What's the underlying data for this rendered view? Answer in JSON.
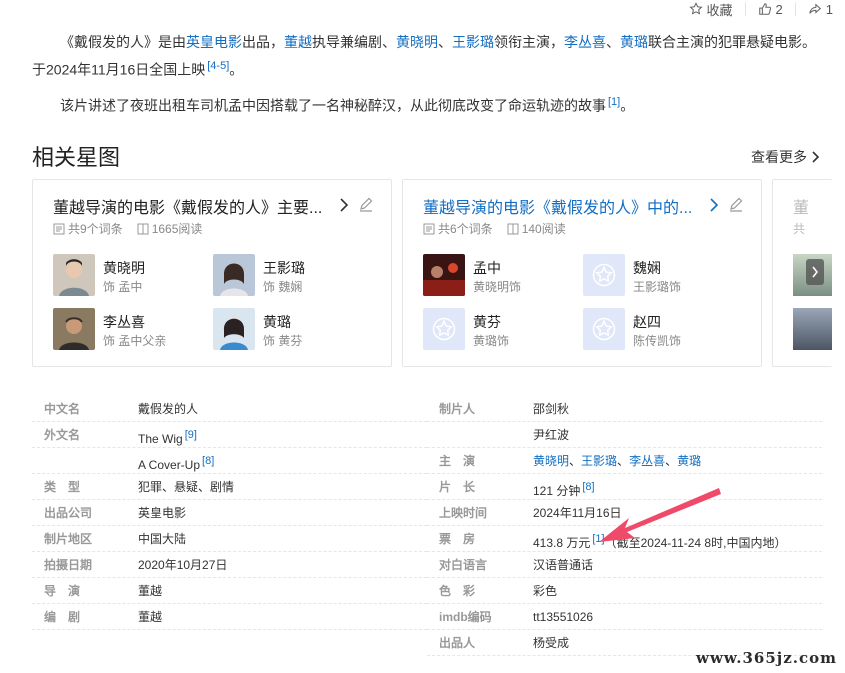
{
  "topbar": {
    "collect": "收藏",
    "like_count": "2",
    "share_count": "1"
  },
  "intro": {
    "p1": {
      "t1": "《戴假发的人》是由",
      "l1": "英皇电影",
      "t2": "出品，",
      "l2": "董越",
      "t3": "执导兼编剧、",
      "l3": "黄晓明",
      "t4": "、",
      "l4": "王影璐",
      "t5": "领衔主演，",
      "l5": "李丛喜",
      "t6": "、",
      "l6": "黄璐",
      "t7": "联合主演的犯罪悬疑电影。于2024年11月16日全国上映",
      "ref": "[4-5]",
      "t8": "。"
    },
    "p2": {
      "text": "该片讲述了夜班出租车司机孟中因搭载了一名神秘醉汉，从此彻底改变了命运轨迹的故事",
      "ref": "[1]",
      "end": "。"
    }
  },
  "section": {
    "title": "相关星图",
    "more": "查看更多"
  },
  "cards": [
    {
      "title": "董越导演的电影《戴假发的人》主要...",
      "entries": "共9个词条",
      "views": "1665阅读",
      "people": [
        {
          "name": "黄晓明",
          "role": "饰 孟中"
        },
        {
          "name": "王影璐",
          "role": "饰 魏娴"
        },
        {
          "name": "李丛喜",
          "role": "饰 孟中父亲"
        },
        {
          "name": "黄璐",
          "role": "饰 黄芬"
        }
      ]
    },
    {
      "title": "董越导演的电影《戴假发的人》中的...",
      "entries": "共6个词条",
      "views": "140阅读",
      "people": [
        {
          "name": "孟中",
          "role": "黄晓明饰"
        },
        {
          "name": "魏娴",
          "role": "王影璐饰"
        },
        {
          "name": "黄芬",
          "role": "黄璐饰"
        },
        {
          "name": "赵四",
          "role": "陈传凯饰"
        }
      ]
    },
    {
      "title": "董",
      "meta": "共"
    }
  ],
  "info": {
    "left": [
      {
        "k": "中文名",
        "v": "戴假发的人"
      },
      {
        "k": "外文名",
        "v": "The Wig",
        "ref": "[9]"
      },
      {
        "k": "",
        "v": "A Cover-Up",
        "ref": "[8]"
      },
      {
        "k": "类　型",
        "v": "犯罪、悬疑、剧情"
      },
      {
        "k": "出品公司",
        "v": "英皇电影"
      },
      {
        "k": "制片地区",
        "v": "中国大陆"
      },
      {
        "k": "拍摄日期",
        "v": "2020年10月27日"
      },
      {
        "k": "导　演",
        "v": "董越"
      },
      {
        "k": "编　剧",
        "v": "董越"
      }
    ],
    "right": [
      {
        "k": "制片人",
        "v": "邵剑秋"
      },
      {
        "k": "",
        "v": "尹红波"
      },
      {
        "k": "主　演",
        "links": [
          "黄晓明",
          "王影璐",
          "李丛喜",
          "黄璐"
        ],
        "sep": "、"
      },
      {
        "k": "片　长",
        "v": "121 分钟",
        "ref": "[8]"
      },
      {
        "k": "上映时间",
        "v": "2024年11月16日"
      },
      {
        "k": "票　房",
        "v": "413.8 万元",
        "ref": "[1]",
        "note": "（截至2024-11-24 8时,中国内地）"
      },
      {
        "k": "对白语言",
        "v": "汉语普通话"
      },
      {
        "k": "色　彩",
        "v": "彩色"
      },
      {
        "k": "imdb编码",
        "v": "tt13551026"
      },
      {
        "k": "出品人",
        "v": "杨受成"
      }
    ]
  },
  "watermark": "www.365jz.com",
  "colors": {
    "link": "#136ec2",
    "arrow": "#f04a6a"
  }
}
